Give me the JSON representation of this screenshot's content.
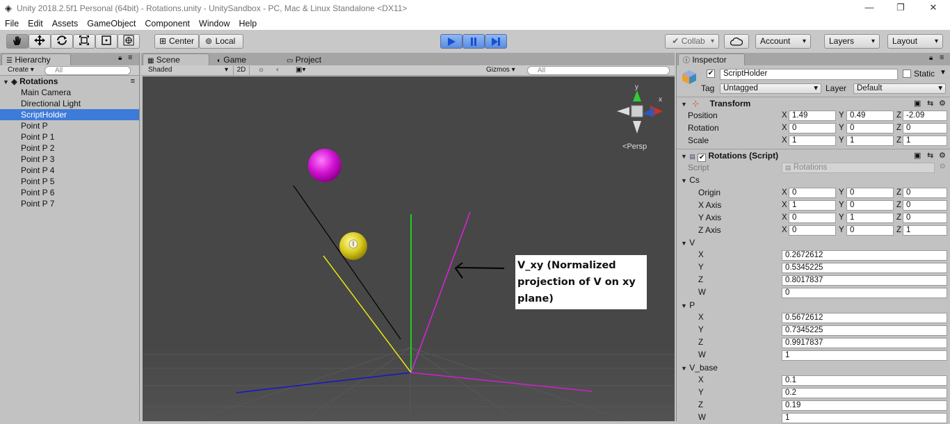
{
  "window": {
    "title": "Unity 2018.2.5f1 Personal (64bit) - Rotations.unity - UnitySandbox - PC, Mac & Linux Standalone <DX11>",
    "minimize": "—",
    "restore": "❐",
    "close": "✕"
  },
  "menu": [
    "File",
    "Edit",
    "Assets",
    "GameObject",
    "Component",
    "Window",
    "Help"
  ],
  "toolbar": {
    "center": "Center",
    "local": "Local",
    "collab": "Collab",
    "account": "Account",
    "layers": "Layers",
    "layout": "Layout",
    "play_color": "#4a8cf0"
  },
  "hierarchy": {
    "tab": "Hierarchy",
    "create": "Create",
    "search_placeholder": "All",
    "scene": "Rotations",
    "items": [
      "Main Camera",
      "Directional Light",
      "ScriptHolder",
      "Point P",
      "Point P 1",
      "Point P 2",
      "Point P 3",
      "Point P 4",
      "Point P 5",
      "Point P 6",
      "Point P 7"
    ],
    "selected": "ScriptHolder",
    "selected_color": "#3d7bd9"
  },
  "tabs": {
    "scene": "Scene",
    "game": "Game",
    "project": "Project"
  },
  "scene_bar": {
    "shading": "Shaded",
    "mode2d": "2D",
    "gizmos": "Gizmos",
    "search_placeholder": "All"
  },
  "scene_view": {
    "persp": "Persp",
    "gizmo_x": "x",
    "gizmo_y": "y",
    "annotation_lines": [
      "V_xy (Normalized",
      "projection of V on xy",
      "plane)"
    ]
  },
  "inspector": {
    "tab": "Inspector",
    "object_name": "ScriptHolder",
    "static": "Static",
    "tag_label": "Tag",
    "tag": "Untagged",
    "layer_label": "Layer",
    "layer": "Default",
    "transform": {
      "title": "Transform",
      "position_label": "Position",
      "rotation_label": "Rotation",
      "scale_label": "Scale",
      "position": [
        "1.49",
        "0.49",
        "-2.09"
      ],
      "rotation": [
        "0",
        "0",
        "0"
      ],
      "scale": [
        "1",
        "1",
        "1"
      ]
    },
    "rotations": {
      "title": "Rotations (Script)",
      "script_label": "Script",
      "script": "Rotations",
      "cs_label": "Cs",
      "origin_label": "Origin",
      "xaxis_label": "X Axis",
      "yaxis_label": "Y Axis",
      "zaxis_label": "Z Axis",
      "origin": [
        "0",
        "0",
        "0"
      ],
      "xaxis": [
        "1",
        "0",
        "0"
      ],
      "yaxis": [
        "0",
        "1",
        "0"
      ],
      "zaxis": [
        "0",
        "0",
        "1"
      ],
      "v_label": "V",
      "v": [
        "0.2672612",
        "0.5345225",
        "0.8017837",
        "0"
      ],
      "p_label": "P",
      "p": [
        "0.5672612",
        "0.7345225",
        "0.9917837",
        "1"
      ],
      "vbase_label": "V_base",
      "vbase": [
        "0.1",
        "0.2",
        "0.19",
        "1"
      ]
    },
    "axis": {
      "x": "X",
      "y": "Y",
      "z": "Z",
      "w": "W"
    }
  }
}
